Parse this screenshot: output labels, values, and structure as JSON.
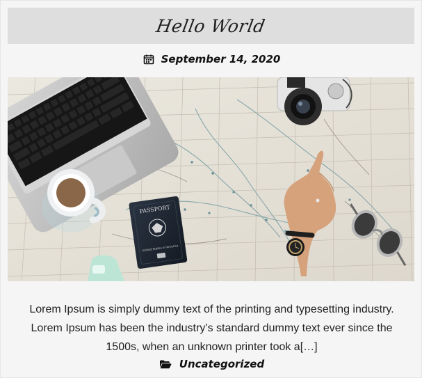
{
  "post": {
    "title": "Hello World",
    "date": "September 14, 2020",
    "excerpt": "Lorem Ipsum is simply dummy text of the printing and typesetting industry. Lorem Ipsum has been the industry’s standard dummy text ever since the 1500s, when an unknown printer took a[…]",
    "category": "Uncategorized"
  },
  "image": {
    "passport_label": "PASSPORT",
    "passport_subtitle": "United States of America"
  },
  "icons": {
    "date": "calendar-icon",
    "category": "folder-open-icon"
  },
  "colors": {
    "background": "#f3f3f3",
    "title_bar": "#dedede",
    "text": "#222222"
  }
}
